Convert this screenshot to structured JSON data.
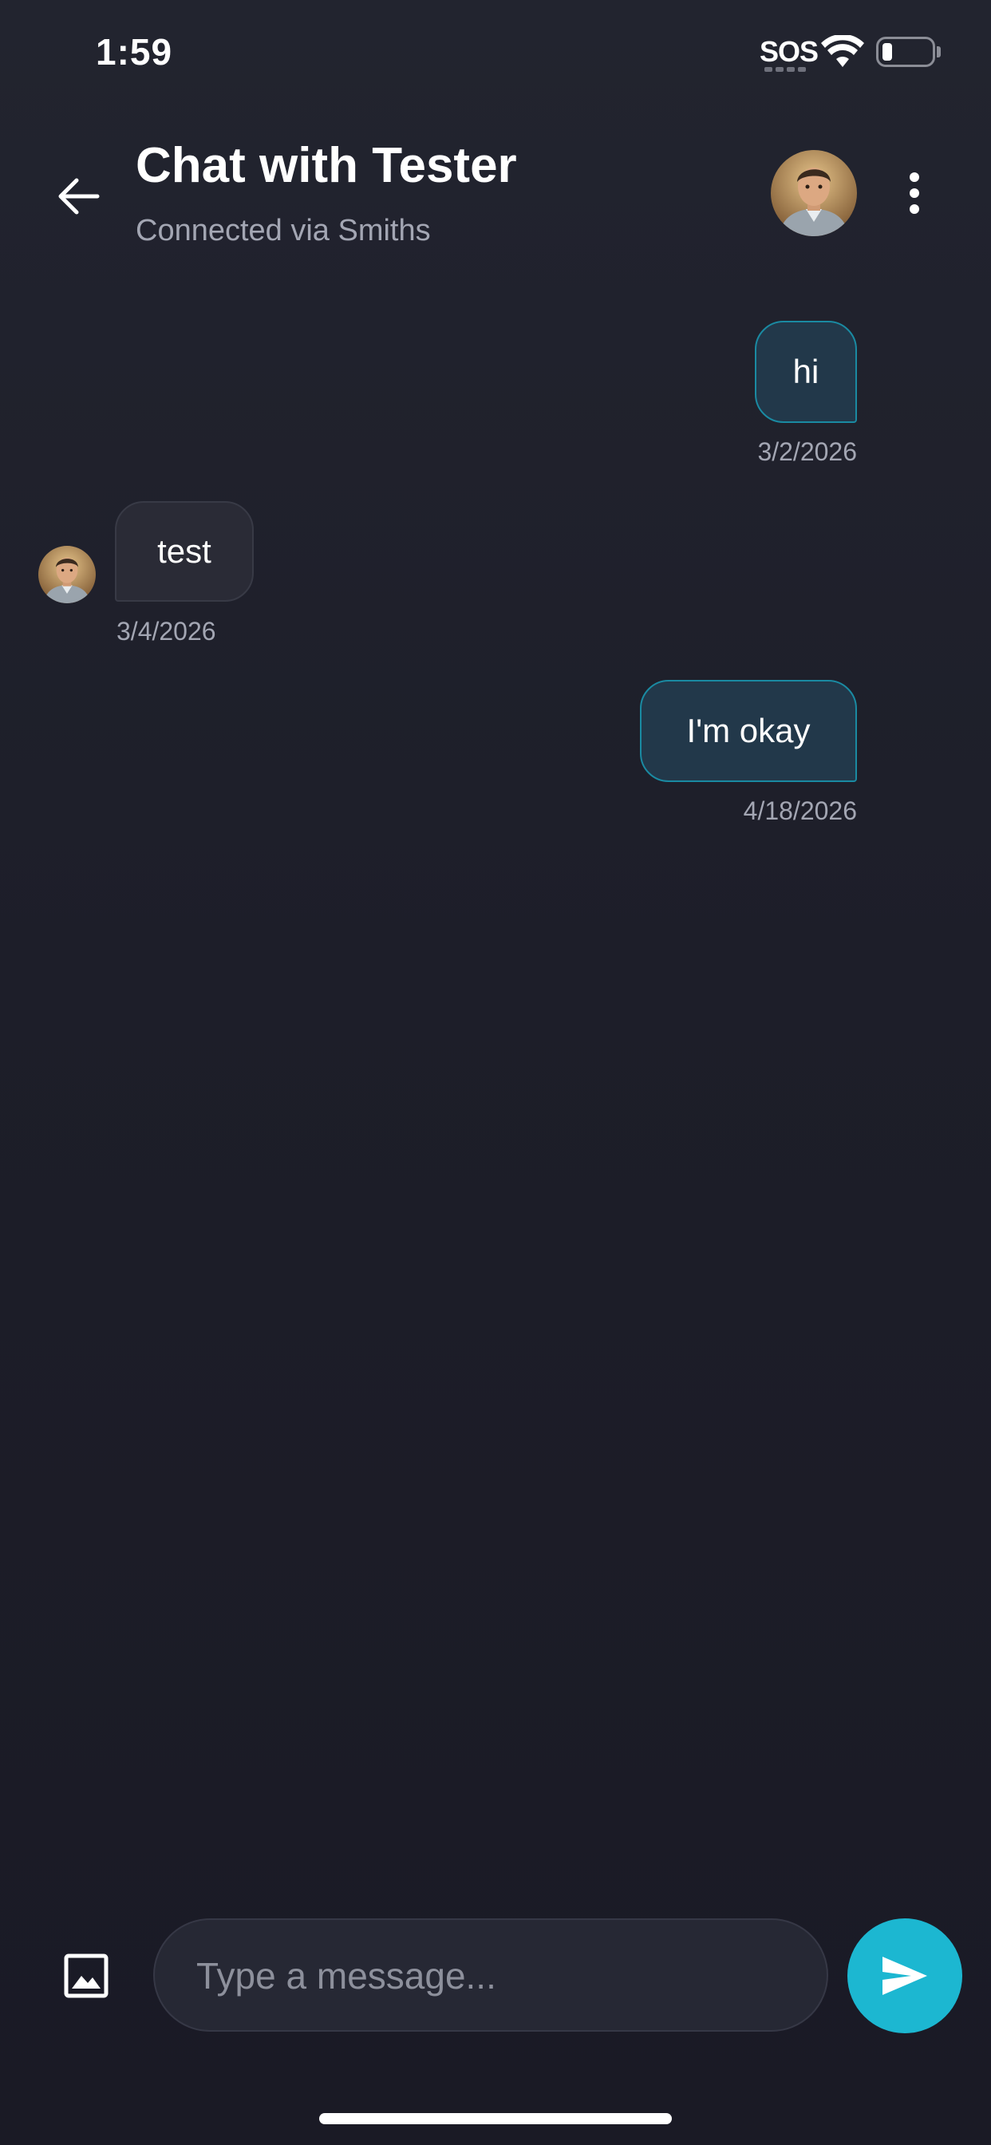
{
  "status_bar": {
    "time": "1:59",
    "sos": "SOS",
    "icons": [
      "wifi-icon",
      "battery-icon"
    ]
  },
  "header": {
    "title": "Chat with Tester",
    "subtitle": "Connected via Smiths",
    "back_icon": "arrow-left-icon",
    "menu_icon": "more-vertical-icon"
  },
  "messages": [
    {
      "direction": "outgoing",
      "text": "hi",
      "date": "3/2/2026"
    },
    {
      "direction": "incoming",
      "text": "test",
      "date": "3/4/2026"
    },
    {
      "direction": "outgoing",
      "text": "I'm okay",
      "date": "4/18/2026"
    }
  ],
  "composer": {
    "placeholder": "Type a message...",
    "value": "",
    "image_icon": "image-icon",
    "send_icon": "send-icon"
  },
  "colors": {
    "background": "#1d1e29",
    "accent": "#1cb7d1",
    "outgoing_bubble": "#22384a",
    "outgoing_border": "#1a8aa2",
    "incoming_bubble": "#2a2b36",
    "muted_text": "#a3a6b3"
  }
}
